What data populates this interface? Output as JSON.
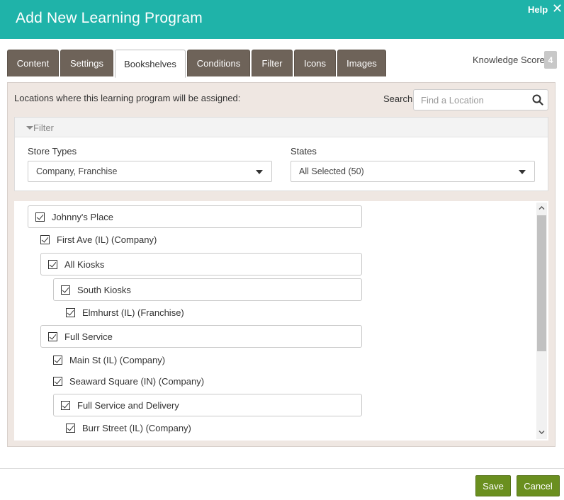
{
  "header": {
    "title": "Add New Learning Program",
    "help_label": "Help",
    "close_glyph": "✕"
  },
  "tabs": [
    {
      "label": "Content"
    },
    {
      "label": "Settings"
    },
    {
      "label": "Bookshelves",
      "active": true
    },
    {
      "label": "Conditions"
    },
    {
      "label": "Filter"
    },
    {
      "label": "Icons"
    },
    {
      "label": "Images"
    }
  ],
  "knowledge_score": {
    "label": "Knowledge Score",
    "value": "4"
  },
  "locations": {
    "label": "Locations where this learning program will be assigned:",
    "search_label": "Search",
    "search_placeholder": "Find a Location"
  },
  "filter": {
    "title": "Filter",
    "store_types_label": "Store Types",
    "store_types_value": "Company, Franchise",
    "states_label": "States",
    "states_value": "All Selected (50)"
  },
  "tree": [
    {
      "label": "Johnny's Place",
      "checked": true,
      "boxed": true,
      "level": 0
    },
    {
      "label": "First Ave (IL) (Company)",
      "checked": true,
      "boxed": false,
      "level": 1
    },
    {
      "label": "All Kiosks",
      "checked": true,
      "boxed": true,
      "level": 1
    },
    {
      "label": "South Kiosks",
      "checked": true,
      "boxed": true,
      "level": 2
    },
    {
      "label": "Elmhurst (IL) (Franchise)",
      "checked": true,
      "boxed": false,
      "level": 3
    },
    {
      "label": "Full Service",
      "checked": true,
      "boxed": true,
      "level": 1
    },
    {
      "label": "Main St (IL) (Company)",
      "checked": true,
      "boxed": false,
      "level": 2
    },
    {
      "label": "Seaward Square (IN) (Company)",
      "checked": true,
      "boxed": false,
      "level": 2
    },
    {
      "label": "Full Service and Delivery",
      "checked": true,
      "boxed": true,
      "level": 2
    },
    {
      "label": "Burr Street (IL) (Company)",
      "checked": true,
      "boxed": false,
      "level": 3
    }
  ],
  "footer": {
    "save_label": "Save",
    "cancel_label": "Cancel"
  },
  "colors": {
    "header": "#1fb3a9",
    "tab": "#6e6359",
    "button": "#6a8f1f",
    "panel": "#efe7e2"
  }
}
